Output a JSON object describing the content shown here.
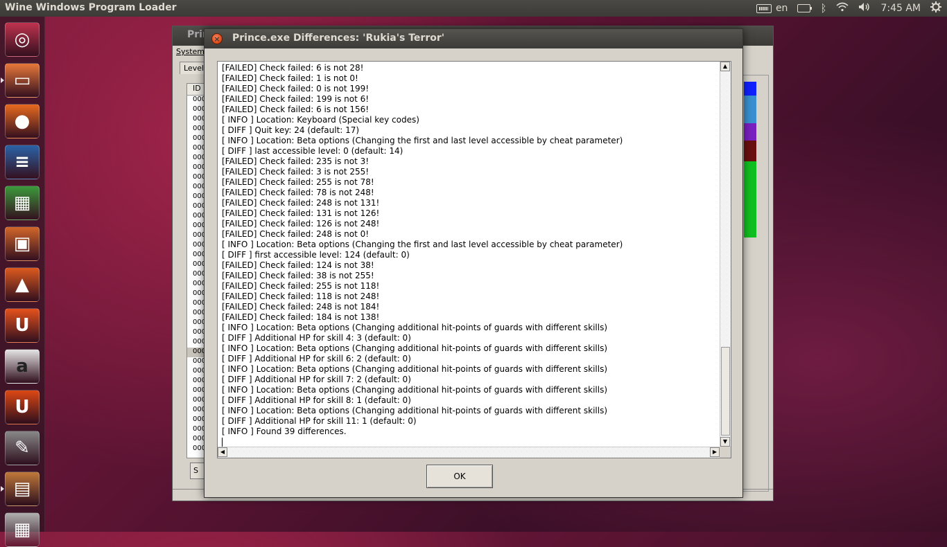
{
  "top_panel": {
    "app_title": "Wine Windows Program Loader",
    "language": "en",
    "time": "7:45 AM"
  },
  "launcher": {
    "items": [
      {
        "name": "dash-home",
        "icon": "ubuntu-logo-icon",
        "color": "#c0334f"
      },
      {
        "name": "files",
        "icon": "folder-icon",
        "color": "#e8783a"
      },
      {
        "name": "firefox",
        "icon": "firefox-icon",
        "color": "#e86a1f"
      },
      {
        "name": "writer",
        "icon": "writer-icon",
        "color": "#2b63a8"
      },
      {
        "name": "calc",
        "icon": "calc-icon",
        "color": "#3c9a3c"
      },
      {
        "name": "impress",
        "icon": "impress-icon",
        "color": "#d2662a"
      },
      {
        "name": "software-center",
        "icon": "shopping-bag-icon",
        "color": "#dd5a1f"
      },
      {
        "name": "ubuntu-one",
        "icon": "ubuntu-one-icon",
        "color": "#e6521d"
      },
      {
        "name": "amazon",
        "icon": "amazon-icon",
        "color": "#e5e5e5"
      },
      {
        "name": "ubuntu-one-music",
        "icon": "music-icon",
        "color": "#dd4814"
      },
      {
        "name": "system-settings",
        "icon": "settings-icon",
        "color": "#888888"
      },
      {
        "name": "wine-program",
        "icon": "wine-icon",
        "color": "#c0793a"
      },
      {
        "name": "workspaces",
        "icon": "workspace-icon",
        "color": "#b0b0b0"
      }
    ]
  },
  "background_window": {
    "title": "Prin",
    "menu": "System",
    "tab": "Level",
    "list_header": "ID",
    "row_text": "000",
    "button_text": "S"
  },
  "dialog": {
    "title": "Prince.exe Differences: 'Rukia's Terror'",
    "ok_label": "OK",
    "log_lines": [
      "[FAILED] Check failed: 6 is not 28!",
      "[FAILED] Check failed: 1 is not 0!",
      "[FAILED] Check failed: 0 is not 199!",
      "[FAILED] Check failed: 199 is not 6!",
      "[FAILED] Check failed: 6 is not 156!",
      "[ INFO ] Location: Keyboard (Special key codes)",
      "[ DIFF ] Quit key: 24 (default: 17)",
      "[ INFO ] Location: Beta options (Changing the first and last level accessible by cheat parameter)",
      "[ DIFF ] last accessible level: 0 (default: 14)",
      "[FAILED] Check failed: 235 is not 3!",
      "[FAILED] Check failed: 3 is not 255!",
      "[FAILED] Check failed: 255 is not 78!",
      "[FAILED] Check failed: 78 is not 248!",
      "[FAILED] Check failed: 248 is not 131!",
      "[FAILED] Check failed: 131 is not 126!",
      "[FAILED] Check failed: 126 is not 248!",
      "[FAILED] Check failed: 248 is not 0!",
      "[ INFO ] Location: Beta options (Changing the first and last level accessible by cheat parameter)",
      "[ DIFF ] first accessible level: 124 (default: 0)",
      "[FAILED] Check failed: 124 is not 38!",
      "[FAILED] Check failed: 38 is not 255!",
      "[FAILED] Check failed: 255 is not 118!",
      "[FAILED] Check failed: 118 is not 248!",
      "[FAILED] Check failed: 248 is not 184!",
      "[FAILED] Check failed: 184 is not 138!",
      "[ INFO ] Location: Beta options (Changing additional hit-points of guards with different skills)",
      "[ DIFF ] Additional HP for skill 4: 3 (default: 0)",
      "[ INFO ] Location: Beta options (Changing additional hit-points of guards with different skills)",
      "[ DIFF ] Additional HP for skill 6: 2 (default: 0)",
      "[ INFO ] Location: Beta options (Changing additional hit-points of guards with different skills)",
      "[ DIFF ] Additional HP for skill 7: 2 (default: 0)",
      "[ INFO ] Location: Beta options (Changing additional hit-points of guards with different skills)",
      "[ DIFF ] Additional HP for skill 8: 1 (default: 0)",
      "[ INFO ] Location: Beta options (Changing additional hit-points of guards with different skills)",
      "[ DIFF ] Additional HP for skill 11: 1 (default: 0)",
      "[ INFO ] Found 39 differences."
    ]
  }
}
